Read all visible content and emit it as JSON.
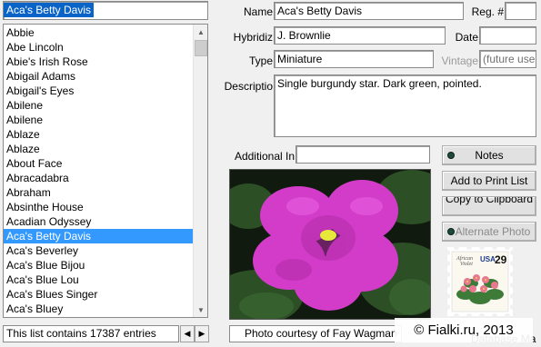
{
  "search": {
    "value": "Aca's Betty Davis"
  },
  "variety_list": {
    "items": [
      "Abbie",
      "Abe Lincoln",
      "Abie's Irish Rose",
      "Abigail Adams",
      "Abigail's Eyes",
      "Abilene",
      "Abilene",
      "Ablaze",
      "Ablaze",
      "About Face",
      "Abracadabra",
      "Abraham",
      "Absinthe House",
      "Acadian Odyssey",
      "Aca's Betty Davis",
      "Aca's Beverley",
      "Aca's Blue Bijou",
      "Aca's Blue Lou",
      "Aca's Blues Singer",
      "Aca's Bluey"
    ],
    "selected_index": 14,
    "status": "This list contains 17387 entries"
  },
  "detail": {
    "name_label": "Name",
    "name_value": "Aca's Betty Davis",
    "reg_label": "Reg. #",
    "reg_value": "",
    "hybridizer_label": "Hybridiz",
    "hybridizer_value": "J. Brownlie",
    "date_label": "Date",
    "date_value": "",
    "type_label": "Type",
    "type_value": "Miniature",
    "vintage_label": "Vintage",
    "vintage_value": "(future use",
    "description_label": "Descriptio",
    "description_value": "Single burgundy star. Dark green, pointed.",
    "additional_label": "Additional In",
    "additional_value": ""
  },
  "buttons": {
    "notes": "Notes",
    "add_to_print": "Add to Print List",
    "copy_clipboard": "Copy to Clipboard",
    "alternate_photo": "Alternate Photo"
  },
  "stamp": {
    "text_line1": "African",
    "text_line2": "Violet",
    "country": "USA",
    "value": "29"
  },
  "photo": {
    "caption": "Photo courtesy of Fay Wagman",
    "partial_label": "Database Ma"
  },
  "watermark": "© Fialki.ru, 2013",
  "colors": {
    "selection": "#3399ff",
    "flower": "#d23cc8",
    "leaf": "#2e5a2a"
  }
}
